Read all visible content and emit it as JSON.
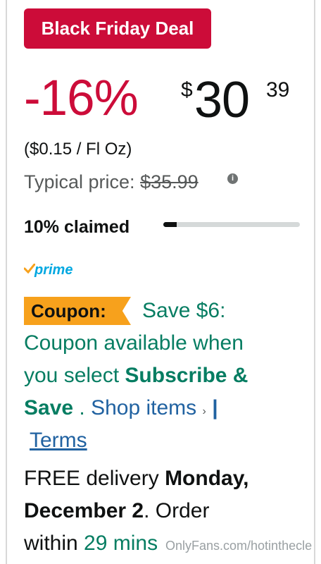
{
  "deal": {
    "badge": "Black Friday Deal"
  },
  "price": {
    "discount": "-16%",
    "currency": "$",
    "whole": "30",
    "fraction": "39",
    "unit_price": "($0.15 / Fl Oz)",
    "typical_label": "Typical price:",
    "typical_value": "$35.99"
  },
  "claimed": {
    "label": "10% claimed",
    "fraction": 0.1
  },
  "prime": {
    "label": "prime"
  },
  "coupon": {
    "tag": "Coupon:",
    "save": "Save $6:",
    "line2": "Coupon available when",
    "line3_prefix": "you select ",
    "line3_bold": "Subscribe &",
    "line4_bold": "Save",
    "line4_dot": " . ",
    "shop_items": "Shop items",
    "chevron": "›",
    "separator": "|",
    "terms": "Terms"
  },
  "delivery": {
    "prefix": "FREE delivery ",
    "date_bold_1": "Monday,",
    "date_bold_2": "December 2",
    "suffix": ". Order",
    "within": "within ",
    "time": "29 mins"
  },
  "watermark": "OnlyFans.com/hotinthecle",
  "colors": {
    "deal_red": "#cc0c39",
    "coupon_orange": "#f7a11c",
    "green": "#067d62",
    "link_blue": "#2162a1",
    "prime_blue": "#00a8e1"
  }
}
